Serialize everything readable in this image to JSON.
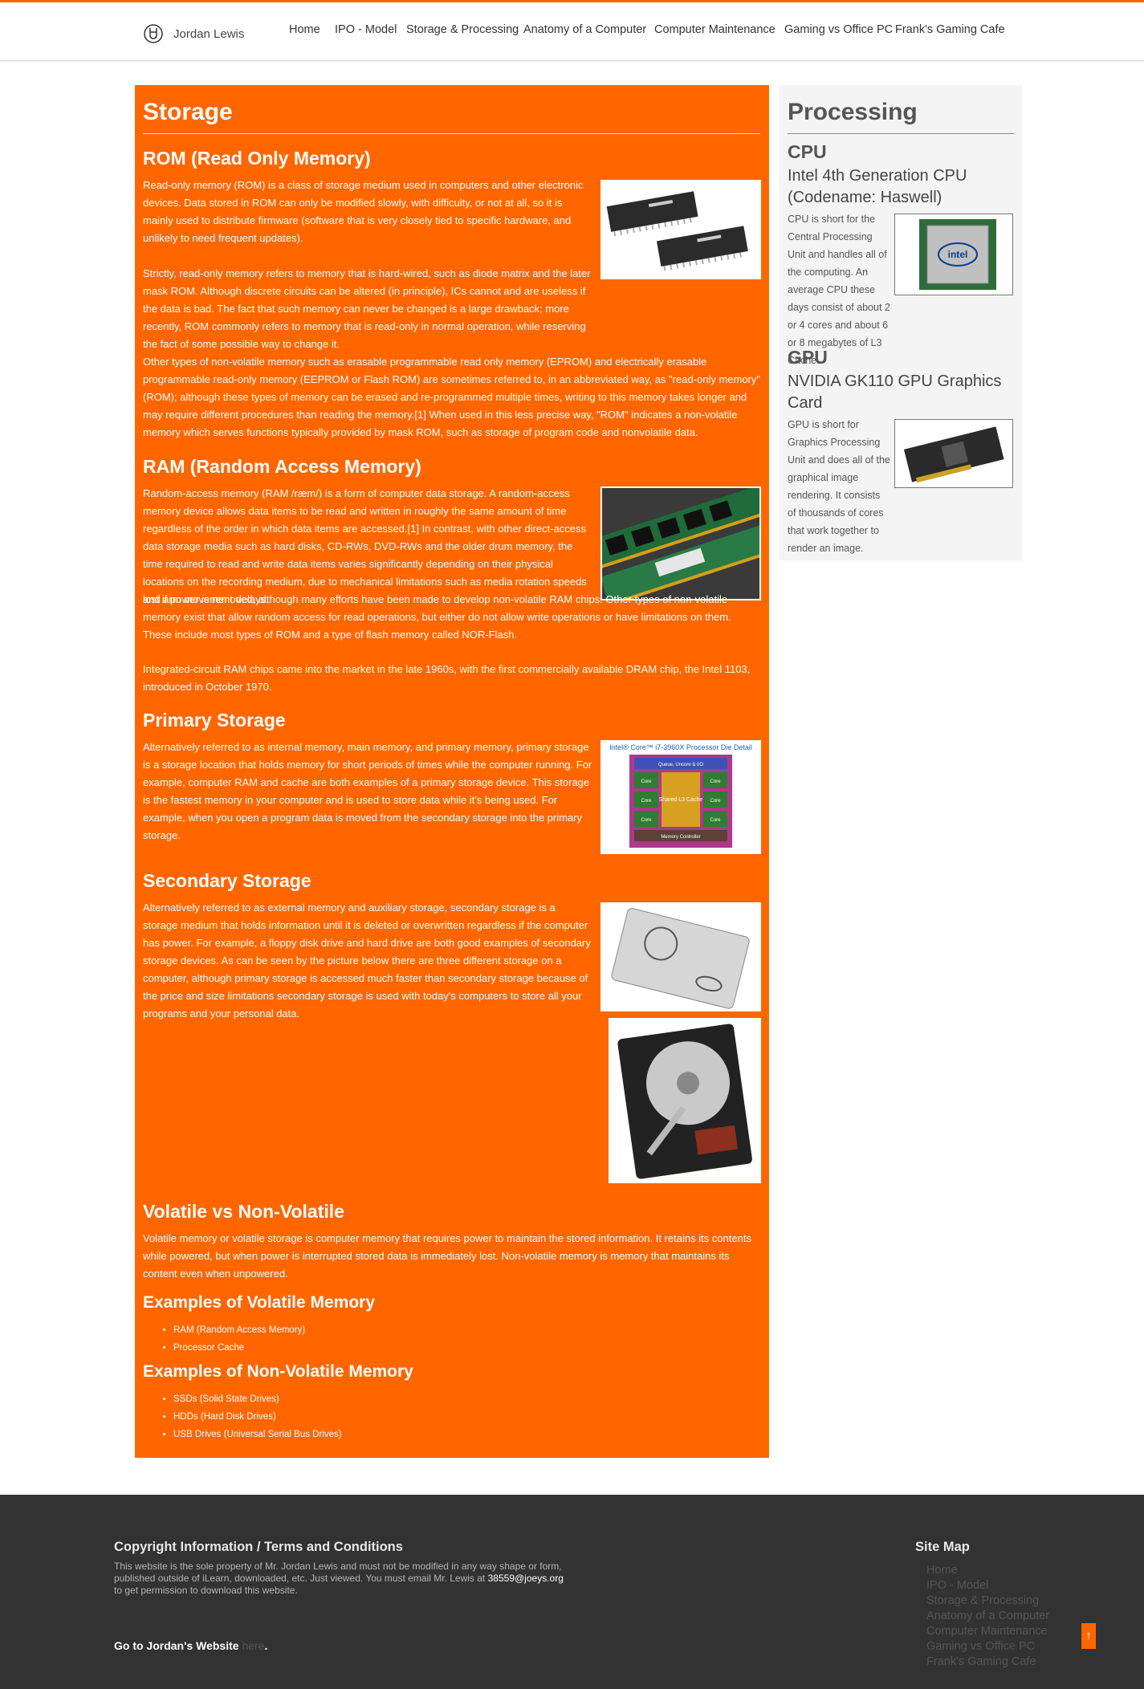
{
  "header": {
    "brand_name": "Jordan Lewis",
    "nav": [
      "Home",
      "IPO - Model",
      "Storage & Processing",
      "Anatomy of a Computer",
      "Computer Maintenance",
      "Gaming vs Office PC",
      "Frank's Gaming Cafe"
    ]
  },
  "storage": {
    "title": "Storage",
    "rom": {
      "heading": "ROM (Read Only Memory)",
      "p1": "Read-only memory (ROM) is a class of storage medium used in computers and other electronic devices. Data stored in ROM can only be modified slowly, with difficulty, or not at all, so it is mainly used to distribute firmware (software that is very closely tied to specific hardware, and unlikely to need frequent updates).",
      "p2": "Strictly, read-only memory refers to memory that is hard-wired, such as diode matrix and the later mask ROM. Although discrete circuits can be altered (in principle), ICs cannot and are useless if the data is bad. The fact that such memory can never be changed is a large drawback; more recently, ROM commonly refers to memory that is read-only in normal operation, while reserving the fact of some possible way to change it.",
      "p3": "Other types of non-volatile memory such as erasable programmable read only memory (EPROM) and electrically erasable programmable read-only memory (EEPROM or Flash ROM) are sometimes referred to, in an abbreviated way, as \"read-only memory\" (ROM); although these types of memory can be erased and re-programmed multiple times, writing to this memory takes longer and may require different procedures than reading the memory.[1] When used in this less precise way, \"ROM\" indicates a non-volatile memory which serves functions typically provided by mask ROM, such as storage of program code and nonvolatile data."
    },
    "ram": {
      "heading": "RAM (Random Access Memory)",
      "p1": "Random-access memory (RAM /ræm/) is a form of computer data storage. A random-access memory device allows data items to be read and written in roughly the same amount of time regardless of the order in which data items are accessed.[1] In contrast, with other direct-access data storage media such as hard disks, CD-RWs, DVD-RWs and the older drum memory, the time required to read and write data items varies significantly depending on their physical locations on the recording medium, due to mechanical limitations such as media rotation speeds and arm movement delays.",
      "p1_overlap": "lost if power is removed, although many efforts have been made to develop non-volatile RAM chips. Other types of non-volatile memory exist that allow random access for read operations, but either do not allow write operations or have limitations on them. These include most types of ROM and a type of flash memory called NOR-Flash.",
      "p2": "Integrated-circuit RAM chips came into the market in the late 1960s, with the first commercially available DRAM chip, the Intel 1103, introduced in October 1970."
    },
    "primary": {
      "heading": "Primary Storage",
      "p1": "Alternatively referred to as internal memory, main memory, and primary memory, primary storage is a storage location that holds memory for short periods of times while the computer running. For example, computer RAM and cache are both examples of a primary storage device. This storage is the fastest memory in your computer and is used to store data while it's being used. For example, when you open a program data is moved from the secondary storage into the primary storage.",
      "img_caption": "Intel® Core™ i7-3960X Processor Die Detail",
      "die_labels": [
        "Queue, Uncore & I/O",
        "Core",
        "Core",
        "Core",
        "Core",
        "Core",
        "Core",
        "Shared L3 Cache",
        "Memory Controller"
      ]
    },
    "secondary": {
      "heading": "Secondary Storage",
      "p1": "Alternatively referred to as external memory and auxiliary storage, secondary storage is a storage medium that holds information until it is deleted or overwritten regardless if the computer has power. For example, a floppy disk drive and hard drive are both good examples of secondary storage devices. As can be seen by the picture below there are three different storage on a computer, although primary storage is accessed much faster than secondary storage because of the price and size limitations secondary storage is used with today's computers to store all your programs and your personal data."
    },
    "volatile": {
      "heading": "Volatile vs Non-Volatile",
      "p1": "Volatile memory or volatile storage is computer memory that requires power to maintain the stored information. It retains its contents while powered, but when power is interrupted stored data is immediately lost. Non-volatile memory is memory that maintains its content even when unpowered.",
      "volatile_heading": "Examples of Volatile Memory",
      "volatile_items": [
        "RAM (Random Access Memory)",
        "Processor Cache"
      ],
      "nonvolatile_heading": "Examples of Non-Volatile Memory",
      "nonvolatile_items": [
        "SSDs (Solid State Drives)",
        "HDDs (Hard Disk Drives)",
        "USB Drives (Universal Serial Bus Drives)"
      ]
    }
  },
  "processing": {
    "title": "Processing",
    "cpu": {
      "heading": "CPU",
      "subheading": "Intel 4th Generation CPU (Codename: Haswell)",
      "text": "CPU is short for the Central Processing Unit and handles all of the computing. An average CPU these days consist of about 2 or 4 cores and about 6 or 8 megabytes of L3 Cache.",
      "chip_brand": "intel"
    },
    "gpu": {
      "heading": "GPU",
      "subheading": "NVIDIA GK110 GPU Graphics Card",
      "text": "GPU is short for Graphics Processing Unit and does all of the graphical image rendering. It consists of thousands of cores that work together to render an image."
    }
  },
  "footer": {
    "copyright_heading": "Copyright Information / Terms and Conditions",
    "copyright_text": "This website is the sole property of Mr. Jordan Lewis and must not be modified in any way shape or form, published outside of iLearn, downloaded, etc. Just viewed. You must email Mr. Lewis at",
    "email": "38559@joeys.org",
    "copyright_tail": "to get permission to download this website.",
    "goto_text": "Go to Jordan's Website",
    "goto_link": "here",
    "sitemap_heading": "Site Map",
    "sitemap": [
      "Home",
      "IPO - Model",
      "Storage & Processing",
      "Anatomy of a Computer",
      "Computer Maintenance",
      "Gaming vs Office PC",
      "Frank's Gaming Cafe"
    ],
    "to_top": "↑"
  }
}
